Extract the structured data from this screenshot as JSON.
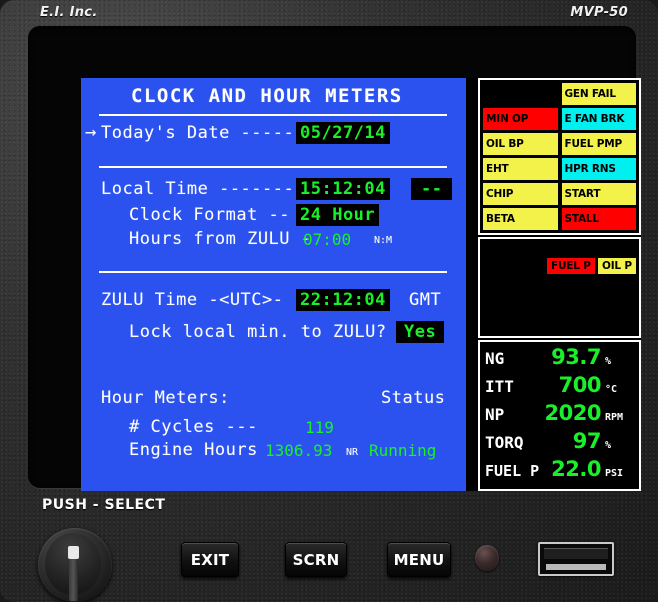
{
  "bezel": {
    "brand_left": "E.I. Inc.",
    "brand_right": "MVP-50",
    "push_select_label": "PUSH - SELECT",
    "buttons": [
      {
        "name": "exit",
        "label": "EXIT"
      },
      {
        "name": "scrn",
        "label": "SCRN"
      },
      {
        "name": "menu",
        "label": "MENU"
      }
    ]
  },
  "page": {
    "title": "CLOCK AND HOUR METERS",
    "cursor": "→",
    "rows": {
      "todays_date": {
        "label": "Today's Date -----",
        "value": "05/27/14"
      },
      "local_time": {
        "label": "Local Time -------",
        "value": "15:12:04",
        "badge": "--"
      },
      "clock_format": {
        "label": "Clock Format --",
        "value": "24 Hour"
      },
      "hours_from_zulu": {
        "label": "Hours from ZULU -",
        "value": "07:00",
        "unit": "N:M"
      },
      "zulu_time": {
        "label": "ZULU Time -<UTC>-",
        "value": "22:12:04",
        "unit": "GMT"
      },
      "lock_local": {
        "label": "Lock local min. to ZULU?",
        "value": "Yes"
      },
      "hour_meters_header": {
        "label": "Hour Meters:",
        "status_header": "Status"
      },
      "cycles": {
        "label": "# Cycles ---",
        "value": "119"
      },
      "engine_hours": {
        "label": "Engine Hours",
        "value": "1306.93",
        "unit": "NR",
        "status": "Running"
      }
    }
  },
  "annunciators": [
    {
      "label": "",
      "color": "blank"
    },
    {
      "label": "GEN FAIL",
      "color": "yellow"
    },
    {
      "label": "MIN OP",
      "color": "red"
    },
    {
      "label": "E FAN BRK",
      "color": "cyan"
    },
    {
      "label": "OIL BP",
      "color": "yellow"
    },
    {
      "label": "FUEL PMP",
      "color": "yellow"
    },
    {
      "label": "EHT",
      "color": "yellow"
    },
    {
      "label": "HPR RNS",
      "color": "cyan"
    },
    {
      "label": "CHIP",
      "color": "yellow"
    },
    {
      "label": "START",
      "color": "yellow"
    },
    {
      "label": "BETA",
      "color": "yellow"
    },
    {
      "label": "STALL",
      "color": "red"
    }
  ],
  "alerts": [
    {
      "label": "FUEL P",
      "color": "red"
    },
    {
      "label": "OIL P",
      "color": "yellow"
    }
  ],
  "gauges": [
    {
      "name": "NG",
      "value": "93.7",
      "unit": "%"
    },
    {
      "name": "ITT",
      "value": "700",
      "unit": "°C"
    },
    {
      "name": "NP",
      "value": "2020",
      "unit": "RPM"
    },
    {
      "name": "TORQ",
      "value": "97",
      "unit": "%"
    },
    {
      "name": "FUEL P",
      "value": "22.0",
      "unit": "PSI"
    }
  ],
  "colors": {
    "screen_blue": "#2b52ef",
    "green": "#19f02a",
    "yellow": "#f2f24b",
    "red": "#fe0000",
    "cyan": "#00efef"
  }
}
